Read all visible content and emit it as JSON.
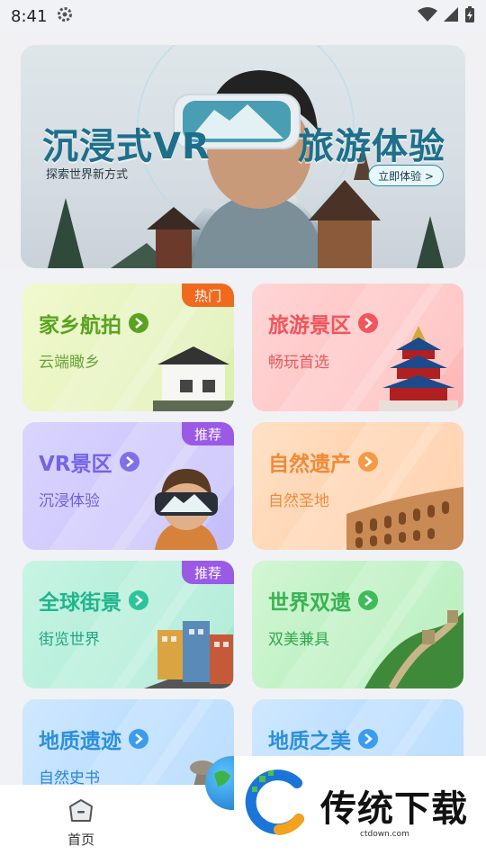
{
  "status_bar": {
    "time": "8:41"
  },
  "banner": {
    "title_left": "沉浸式VR",
    "title_right": "旅游体验",
    "subtitle": "探索世界新方式",
    "button": "立即体验 >"
  },
  "cards": [
    {
      "title": "家乡航拍",
      "subtitle": "云端瞰乡",
      "badge": "热门",
      "accent": "#5aa321"
    },
    {
      "title": "旅游景区",
      "subtitle": "畅玩首选",
      "badge": "",
      "accent": "#f0565c"
    },
    {
      "title": "VR景区",
      "subtitle": "沉浸体验",
      "badge": "推荐",
      "accent": "#7464e6"
    },
    {
      "title": "自然遗产",
      "subtitle": "自然圣地",
      "badge": "",
      "accent": "#f28a36"
    },
    {
      "title": "全球街景",
      "subtitle": "街览世界",
      "badge": "推荐",
      "accent": "#1fb68c"
    },
    {
      "title": "世界双遗",
      "subtitle": "双美兼具",
      "badge": "",
      "accent": "#38b352"
    },
    {
      "title": "地质遗迹",
      "subtitle": "自然史书",
      "badge": "",
      "accent": "#2c8fe0"
    },
    {
      "title": "地质之美",
      "subtitle": "",
      "badge": "",
      "accent": "#2c8fe0"
    }
  ],
  "bottom_nav": {
    "home_label": "首页"
  },
  "watermark": {
    "text": "传统下载",
    "url": "ctdown.com"
  }
}
